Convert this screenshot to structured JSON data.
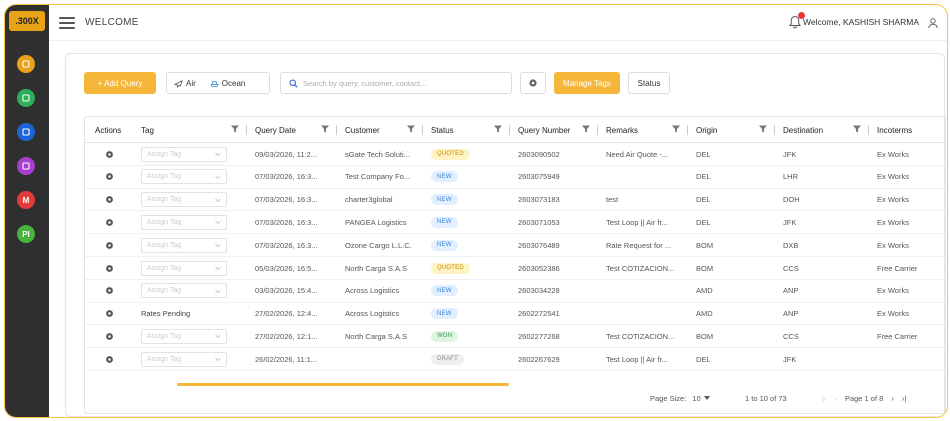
{
  "sidebar": {
    "logo": ".300X",
    "icons": [
      {
        "name": "document-icon",
        "color": "#e8a317"
      },
      {
        "name": "package-icon",
        "color": "#2eae5b"
      },
      {
        "name": "briefcase-icon",
        "color": "#1e63d6"
      },
      {
        "name": "users-icon",
        "color": "#a83fd1"
      },
      {
        "name": "badge-icon",
        "color": "#e23b3b",
        "label": "M"
      },
      {
        "name": "pi-icon",
        "color": "#47b33a",
        "label": "PI"
      }
    ]
  },
  "header": {
    "title": "WELCOME",
    "welcome": "Welcome, KASHISH SHARMA"
  },
  "toolbar": {
    "add_label": "+ Add Query",
    "air_label": "Air",
    "ocean_label": "Ocean",
    "search_placeholder": "Search by query, customer, contact...",
    "manage_tags_label": "Manage Tags",
    "status_label": "Status"
  },
  "table": {
    "columns": [
      "Actions",
      "Tag",
      "Query Date",
      "Customer",
      "Status",
      "Query Number",
      "Remarks",
      "Origin",
      "Destination",
      "Incoterms"
    ],
    "rows": [
      {
        "tag": "Assign Tag",
        "tag_filled": false,
        "date": "09/03/2026, 11:2...",
        "customer": "sGate Tech Soluti...",
        "status": "QUOTED",
        "query_number": "2603090502",
        "remarks": "Need Air Quote -...",
        "origin": "DEL",
        "destination": "JFK",
        "incoterms": "Ex Works"
      },
      {
        "tag": "Assign Tag",
        "tag_filled": false,
        "date": "07/03/2026, 16:3...",
        "customer": "Test Company Fo...",
        "status": "NEW",
        "query_number": "2603075949",
        "remarks": "",
        "origin": "DEL",
        "destination": "LHR",
        "incoterms": "Ex Works"
      },
      {
        "tag": "Assign Tag",
        "tag_filled": false,
        "date": "07/03/2026, 16:3...",
        "customer": "charter3global",
        "status": "NEW",
        "query_number": "2603073183",
        "remarks": "test",
        "origin": "DEL",
        "destination": "DOH",
        "incoterms": "Ex Works"
      },
      {
        "tag": "Assign Tag",
        "tag_filled": false,
        "date": "07/03/2026, 16:3...",
        "customer": "PANGEA Logistics",
        "status": "NEW",
        "query_number": "2603071053",
        "remarks": "Test Loop || Air fr...",
        "origin": "DEL",
        "destination": "JFK",
        "incoterms": "Ex Works"
      },
      {
        "tag": "Assign Tag",
        "tag_filled": false,
        "date": "07/03/2026, 16:3...",
        "customer": "Ozone Cargo L.L.C.",
        "status": "NEW",
        "query_number": "2603076489",
        "remarks": "Rate Request for ...",
        "origin": "BOM",
        "destination": "DXB",
        "incoterms": "Ex Works"
      },
      {
        "tag": "Assign Tag",
        "tag_filled": false,
        "date": "05/03/2026, 16:5...",
        "customer": "North Carga S.A.S",
        "status": "QUOTED",
        "query_number": "2603052386",
        "remarks": "Test COTIZACION...",
        "origin": "BOM",
        "destination": "CCS",
        "incoterms": "Free Carrier"
      },
      {
        "tag": "Assign Tag",
        "tag_filled": false,
        "date": "03/03/2026, 15:4...",
        "customer": "Across Logistics",
        "status": "NEW",
        "query_number": "2603034228",
        "remarks": "",
        "origin": "AMD",
        "destination": "ANP",
        "incoterms": "Ex Works"
      },
      {
        "tag": "Rates Pending",
        "tag_filled": true,
        "date": "27/02/2026, 12:4...",
        "customer": "Across Logistics",
        "status": "NEW",
        "query_number": "2602272541",
        "remarks": "",
        "origin": "AMD",
        "destination": "ANP",
        "incoterms": "Ex Works"
      },
      {
        "tag": "Assign Tag",
        "tag_filled": false,
        "date": "27/02/2026, 12:1...",
        "customer": "North Carga S.A.S",
        "status": "WON",
        "query_number": "2602277268",
        "remarks": "Test COTIZACION...",
        "origin": "BOM",
        "destination": "CCS",
        "incoterms": "Free Carrier"
      },
      {
        "tag": "Assign Tag",
        "tag_filled": false,
        "date": "26/02/2026, 11:1...",
        "customer": "",
        "status": "DRAFT",
        "query_number": "2602267629",
        "remarks": "Test Loop || Air fr...",
        "origin": "DEL",
        "destination": "JFK",
        "incoterms": ""
      }
    ]
  },
  "status_colors": {
    "QUOTED": {
      "bg": "#fff3c4",
      "fg": "#c98a00"
    },
    "NEW": {
      "bg": "#e1efff",
      "fg": "#3b82d6"
    },
    "WON": {
      "bg": "#dff5e3",
      "fg": "#2e9a4a"
    },
    "DRAFT": {
      "bg": "#efefef",
      "fg": "#888888"
    }
  },
  "pagination": {
    "page_size_label": "Page Size:",
    "page_size": "10",
    "range": "1 to 10 of 73",
    "page_label": "Page 1 of 8"
  }
}
